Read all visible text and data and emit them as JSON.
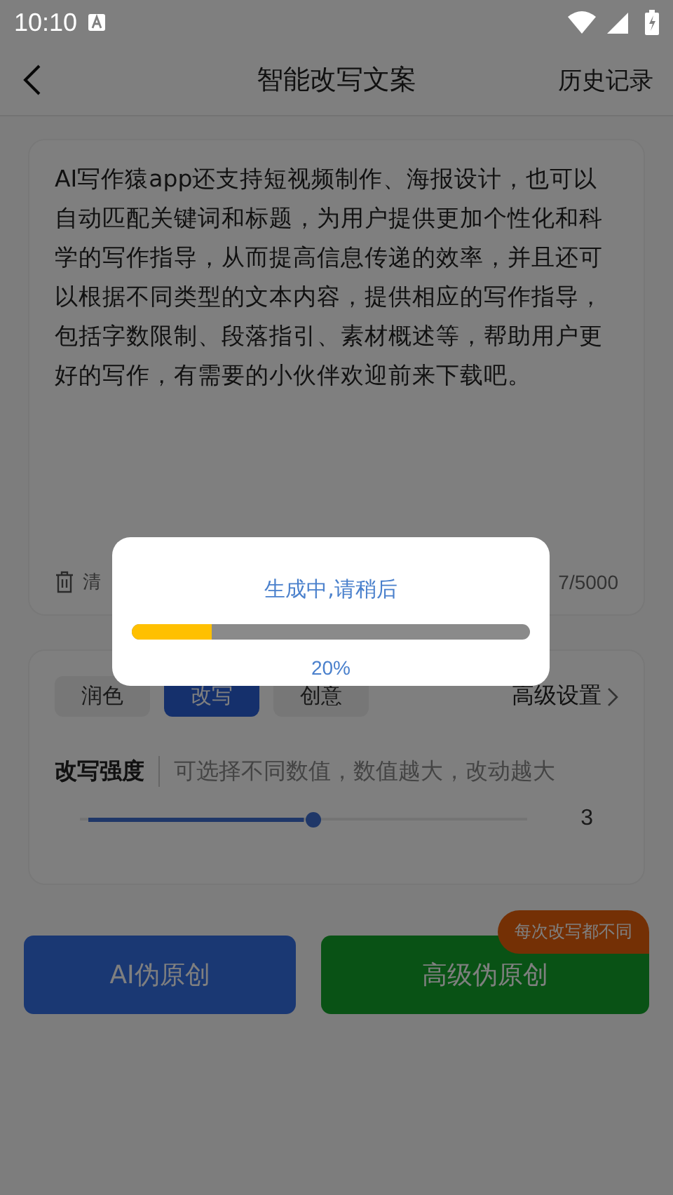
{
  "status_bar": {
    "time": "10:10"
  },
  "header": {
    "title": "智能改写文案",
    "action": "历史记录"
  },
  "editor": {
    "text": "AI写作猿app还支持短视频制作、海报设计，也可以自动匹配关键词和标题，为用户提供更加个性化和科学的写作指导，从而提高信息传递的效率，并且还可以根据不同类型的文本内容，提供相应的写作指导，包括字数限制、段落指引、素材概述等，帮助用户更好的写作，有需要的小伙伴欢迎前来下载吧。",
    "clear_label": "清",
    "counter": "7/5000"
  },
  "modes": [
    {
      "label": "润色",
      "selected": false
    },
    {
      "label": "改写",
      "selected": true
    },
    {
      "label": "创意",
      "selected": false
    }
  ],
  "advanced": "高级设置",
  "strength": {
    "label": "改写强度",
    "hint": "可选择不同数值，数值越大，改动越大",
    "level": 0.5,
    "value": "3"
  },
  "buttons": [
    {
      "label": "AI伪原创",
      "kind": "primary"
    },
    {
      "label": "高级伪原创",
      "kind": "premium",
      "badge": "每次改写都不同"
    }
  ],
  "dialog": {
    "title": "生成中,请稍后",
    "level": 0.2,
    "percent": "20%"
  }
}
